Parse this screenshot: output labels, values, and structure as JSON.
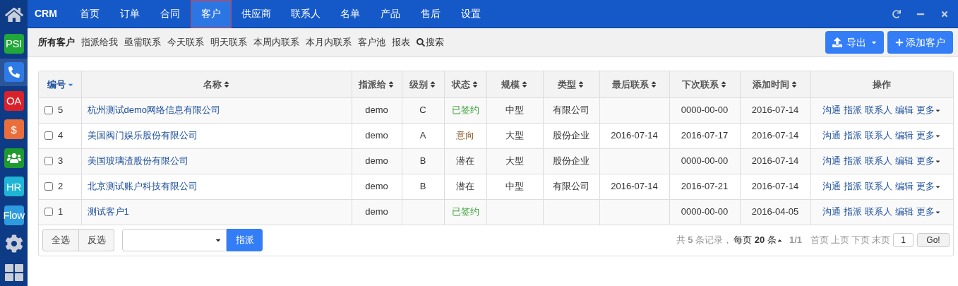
{
  "sidebar": {
    "apps": [
      {
        "kind": "home",
        "selected": false
      },
      {
        "kind": "text",
        "label": "PSI",
        "color": "#22a73a",
        "selected": false
      },
      {
        "kind": "phone",
        "color": "#2f7be6",
        "selected": true
      },
      {
        "kind": "text",
        "label": "OA",
        "color": "#d9212c",
        "selected": false
      },
      {
        "kind": "text",
        "label": "$",
        "color": "#ea6e3c",
        "selected": false
      },
      {
        "kind": "people",
        "color": "#1f9a2e",
        "selected": false
      },
      {
        "kind": "text",
        "label": "HR",
        "color": "#1fb6d6",
        "selected": false
      },
      {
        "kind": "text",
        "label": "Flow",
        "color": "#2e9be0",
        "selected": false
      },
      {
        "kind": "gear",
        "selected": false
      },
      {
        "kind": "grid",
        "selected": false
      }
    ]
  },
  "topbar": {
    "brand": "CRM",
    "nav": [
      {
        "label": "首页",
        "selected": false
      },
      {
        "label": "订单",
        "selected": false
      },
      {
        "label": "合同",
        "selected": false
      },
      {
        "label": "客户",
        "selected": true
      },
      {
        "label": "供应商",
        "selected": false
      },
      {
        "label": "联系人",
        "selected": false
      },
      {
        "label": "名单",
        "selected": false
      },
      {
        "label": "产品",
        "selected": false
      },
      {
        "label": "售后",
        "selected": false
      },
      {
        "label": "设置",
        "selected": false
      }
    ]
  },
  "subnav": {
    "items": [
      {
        "label": "所有客户",
        "selected": true
      },
      {
        "label": "指派给我",
        "selected": false
      },
      {
        "label": "亟需联系",
        "selected": false
      },
      {
        "label": "今天联系",
        "selected": false
      },
      {
        "label": "明天联系",
        "selected": false
      },
      {
        "label": "本周内联系",
        "selected": false
      },
      {
        "label": "本月内联系",
        "selected": false
      },
      {
        "label": "客户池",
        "selected": false
      },
      {
        "label": "报表",
        "selected": false
      }
    ],
    "search": "搜索",
    "export_button": "导出",
    "add_button": "添加客户"
  },
  "table": {
    "columns": [
      {
        "label": "编号",
        "sortable": true,
        "sorted": true
      },
      {
        "label": "名称",
        "sortable": true,
        "sorted": false
      },
      {
        "label": "指派给",
        "sortable": true,
        "sorted": false
      },
      {
        "label": "级别",
        "sortable": true,
        "sorted": false
      },
      {
        "label": "状态",
        "sortable": true,
        "sorted": false
      },
      {
        "label": "规模",
        "sortable": true,
        "sorted": false
      },
      {
        "label": "类型",
        "sortable": true,
        "sorted": false
      },
      {
        "label": "最后联系",
        "sortable": true,
        "sorted": false
      },
      {
        "label": "下次联系",
        "sortable": true,
        "sorted": false
      },
      {
        "label": "添加时间",
        "sortable": true,
        "sorted": false
      },
      {
        "label": "操作",
        "sortable": false
      }
    ],
    "rows": [
      {
        "checked": false,
        "id": "5",
        "name": "杭州测试demo网络信息有限公司",
        "assignee": "demo",
        "level": "C",
        "status": {
          "text": "已签约",
          "kind": "signed"
        },
        "scale": "中型",
        "type": "有限公司",
        "last_contact": "",
        "next_contact": "0000-00-00",
        "added": "2016-07-14",
        "actions": [
          "沟通",
          "指派",
          "联系人",
          "编辑",
          "更多"
        ]
      },
      {
        "checked": false,
        "id": "4",
        "name": "美国阀门娱乐股份有限公司",
        "assignee": "demo",
        "level": "A",
        "status": {
          "text": "意向",
          "kind": "intent"
        },
        "scale": "大型",
        "type": "股份企业",
        "last_contact": "2016-07-14",
        "next_contact": "2016-07-17",
        "added": "2016-07-14",
        "actions": [
          "沟通",
          "指派",
          "联系人",
          "编辑",
          "更多"
        ]
      },
      {
        "checked": false,
        "id": "3",
        "name": "美国玻璃渣股份有限公司",
        "assignee": "demo",
        "level": "B",
        "status": {
          "text": "潜在",
          "kind": "potential"
        },
        "scale": "大型",
        "type": "股份企业",
        "last_contact": "",
        "next_contact": "0000-00-00",
        "added": "2016-07-14",
        "actions": [
          "沟通",
          "指派",
          "联系人",
          "编辑",
          "更多"
        ]
      },
      {
        "checked": false,
        "id": "2",
        "name": "北京测试账户科技有限公司",
        "assignee": "demo",
        "level": "B",
        "status": {
          "text": "潜在",
          "kind": "potential"
        },
        "scale": "中型",
        "type": "有限公司",
        "last_contact": "2016-07-14",
        "next_contact": "2016-07-21",
        "added": "2016-07-14",
        "actions": [
          "沟通",
          "指派",
          "联系人",
          "编辑",
          "更多"
        ]
      },
      {
        "checked": false,
        "id": "1",
        "name": "测试客户1",
        "assignee": "demo",
        "level": "",
        "status": {
          "text": "已签约",
          "kind": "signed"
        },
        "scale": "",
        "type": "",
        "last_contact": "",
        "next_contact": "0000-00-00",
        "added": "2016-04-05",
        "actions": [
          "沟通",
          "指派",
          "联系人",
          "编辑",
          "更多"
        ]
      }
    ]
  },
  "footer": {
    "select_all": "全选",
    "invert": "反选",
    "assign_button": "指派",
    "summary": "共 **5** 条记录，",
    "per_page": "每页 **20** 条",
    "page_count": "1/1",
    "pages": [
      "首页",
      "上页",
      "下页",
      "末页"
    ],
    "page_input": "1",
    "go_button": "Go!"
  }
}
